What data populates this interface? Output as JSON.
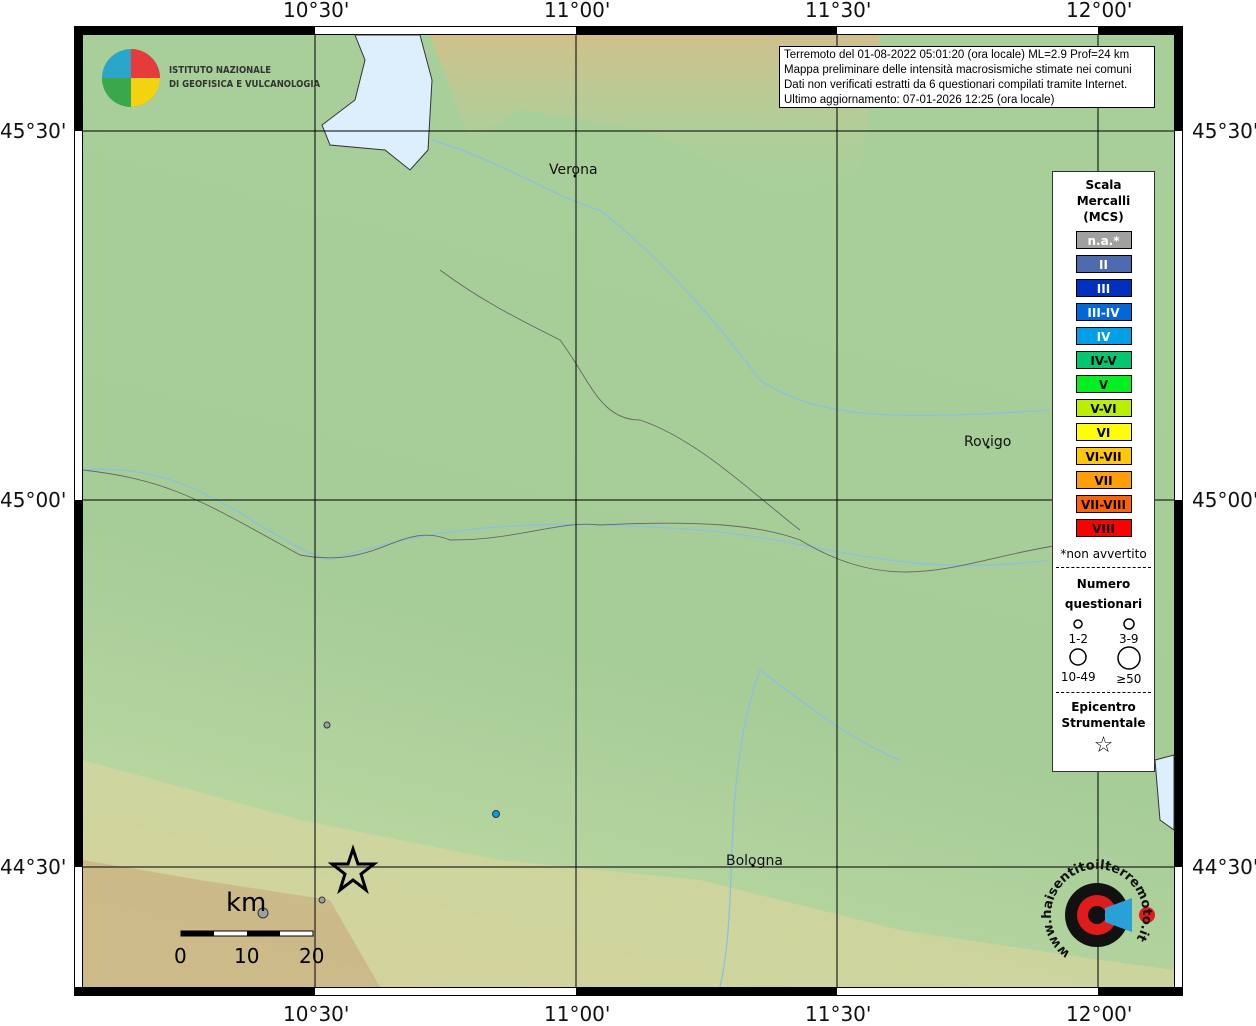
{
  "info": {
    "line1": "Terremoto del 01-08-2022 05:01:20 (ora locale) ML=2.9 Prof=24 km",
    "line2": "Mappa preliminare delle intensità macrosismiche stimate nei comuni",
    "line3": "Dati non verificati estratti da 6 questionari compilati tramite Internet.",
    "line4": "Ultimo aggiornamento: 07-01-2026 12:25 (ora locale)"
  },
  "logo": {
    "line1": "ISTITUTO NAZIONALE",
    "line2": "DI GEOFISICA E VULCANOLOGIA"
  },
  "axes": {
    "lon": [
      "10°30'",
      "11°00'",
      "11°30'",
      "12°00'"
    ],
    "lat": [
      "45°30'",
      "45°00'",
      "44°30'"
    ]
  },
  "cities": [
    "Verona",
    "Rovigo",
    "Bologna"
  ],
  "legend": {
    "title1": "Scala",
    "title2": "Mercalli",
    "title3": "(MCS)",
    "items": [
      {
        "label": "n.a.*",
        "color": "#a0a0a0"
      },
      {
        "label": "II",
        "color": "#4f6bb0"
      },
      {
        "label": "III",
        "color": "#0030c0"
      },
      {
        "label": "III-IV",
        "color": "#0068d8"
      },
      {
        "label": "IV",
        "color": "#00a0e8"
      },
      {
        "label": "IV-V",
        "color": "#00c870"
      },
      {
        "label": "V",
        "color": "#00f020"
      },
      {
        "label": "V-VI",
        "color": "#b8f000"
      },
      {
        "label": "VI",
        "color": "#ffff00"
      },
      {
        "label": "VI-VII",
        "color": "#ffc800"
      },
      {
        "label": "VII",
        "color": "#ffa000"
      },
      {
        "label": "VII-VIII",
        "color": "#ff6400"
      },
      {
        "label": "VIII",
        "color": "#ff0000"
      }
    ],
    "note": "*non avvertito",
    "q_title1": "Numero",
    "q_title2": "questionari",
    "q": [
      "1-2",
      "3-9",
      "10-49",
      "≥50"
    ],
    "epi1": "Epicentro",
    "epi2": "Strumentale"
  },
  "scale": {
    "unit": "km",
    "labels": [
      "0",
      "10",
      "20"
    ]
  },
  "watermark": "www.haisentitoilterremoto.it"
}
